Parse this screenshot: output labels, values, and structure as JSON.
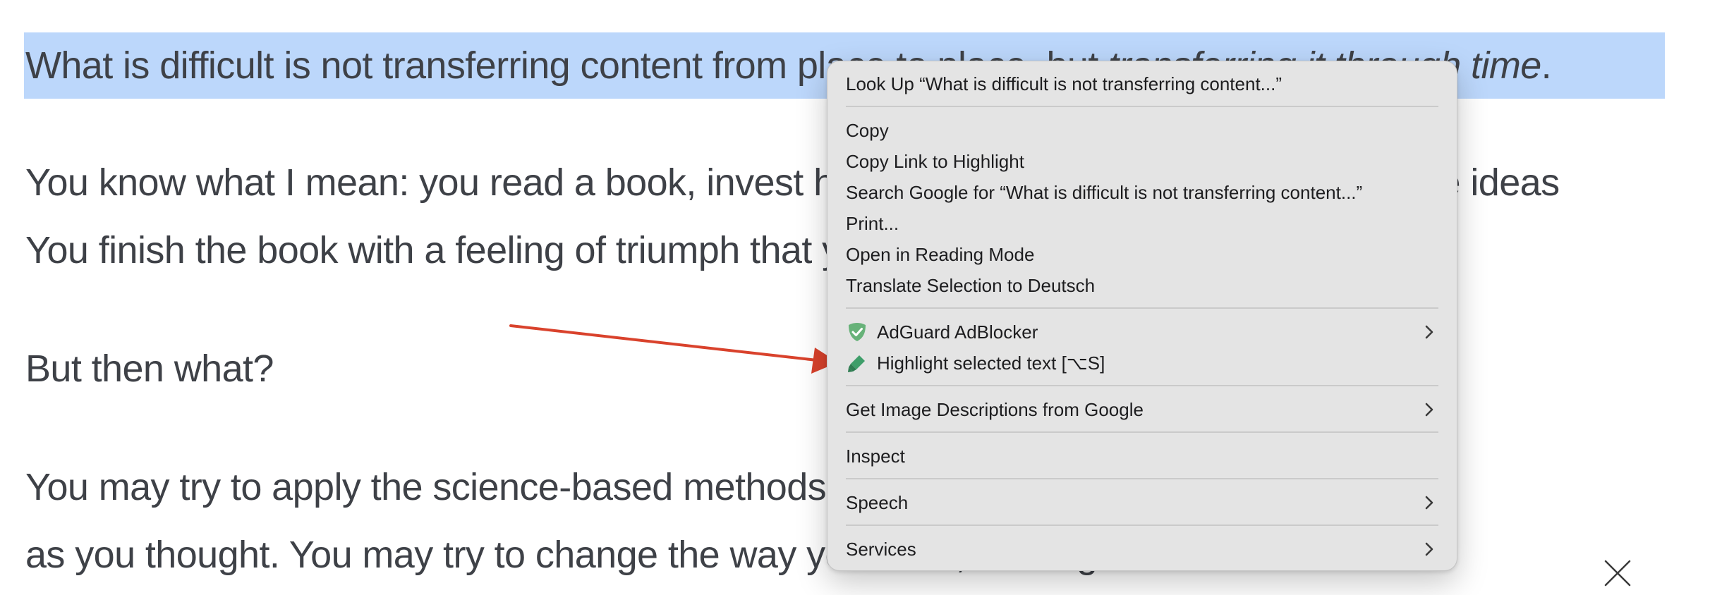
{
  "article": {
    "selected_prefix": "What is difficult is not transferring content from place to place, but ",
    "selected_italic": "transferring it through time",
    "selected_suffix": ".",
    "line2": "You know what I mean: you read a book, invest hours and hours into understanding the ideas",
    "line3": "You finish the book with a feeling of triumph that you have gained new knowledge.",
    "line4": "But then what?",
    "line5": "You may try to apply the science-based methods, only to realize it’s not quite",
    "line6": "as you thought. You may try to change the way you work, trusting"
  },
  "context_menu": {
    "look_up": "Look Up “What is difficult is not transferring content...”",
    "copy": "Copy",
    "copy_link": "Copy Link to Highlight",
    "search_google": "Search Google for “What is difficult is not transferring content...”",
    "print": "Print...",
    "reading_mode": "Open in Reading Mode",
    "translate": "Translate Selection to Deutsch",
    "adguard": "AdGuard AdBlocker",
    "highlight": "Highlight selected text [⌥S]",
    "image_descriptions": "Get Image Descriptions from Google",
    "inspect": "Inspect",
    "speech": "Speech",
    "services": "Services"
  },
  "icons": {
    "adguard": "adguard-shield-icon",
    "highlight": "highlighter-pen-icon",
    "submenu": "chevron-right-icon",
    "close": "close-icon"
  },
  "colors": {
    "selection": "#bcd7fb",
    "arrow": "#d9422c",
    "adguard_green": "#67b279",
    "highlighter_green": "#3f9e6a"
  }
}
